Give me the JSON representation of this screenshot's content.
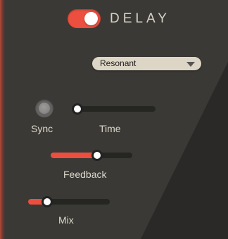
{
  "header": {
    "title": "DELAY",
    "power_on": true
  },
  "mode_select": {
    "value": "Resonant"
  },
  "controls": {
    "sync": {
      "label": "Sync",
      "active": false
    },
    "time": {
      "label": "Time",
      "value": 0.05
    },
    "feedback": {
      "label": "Feedback",
      "value": 0.57
    },
    "mix": {
      "label": "Mix",
      "value": 0.23
    }
  },
  "colors": {
    "accent": "#ec4f3f",
    "panel": "#3a3935",
    "panel_dark": "#2a2927",
    "label": "#ddd8cb",
    "dropdown_bg": "#ddd6c6"
  },
  "icons": {
    "dropdown": "triangle-down",
    "power": "toggle-switch"
  }
}
